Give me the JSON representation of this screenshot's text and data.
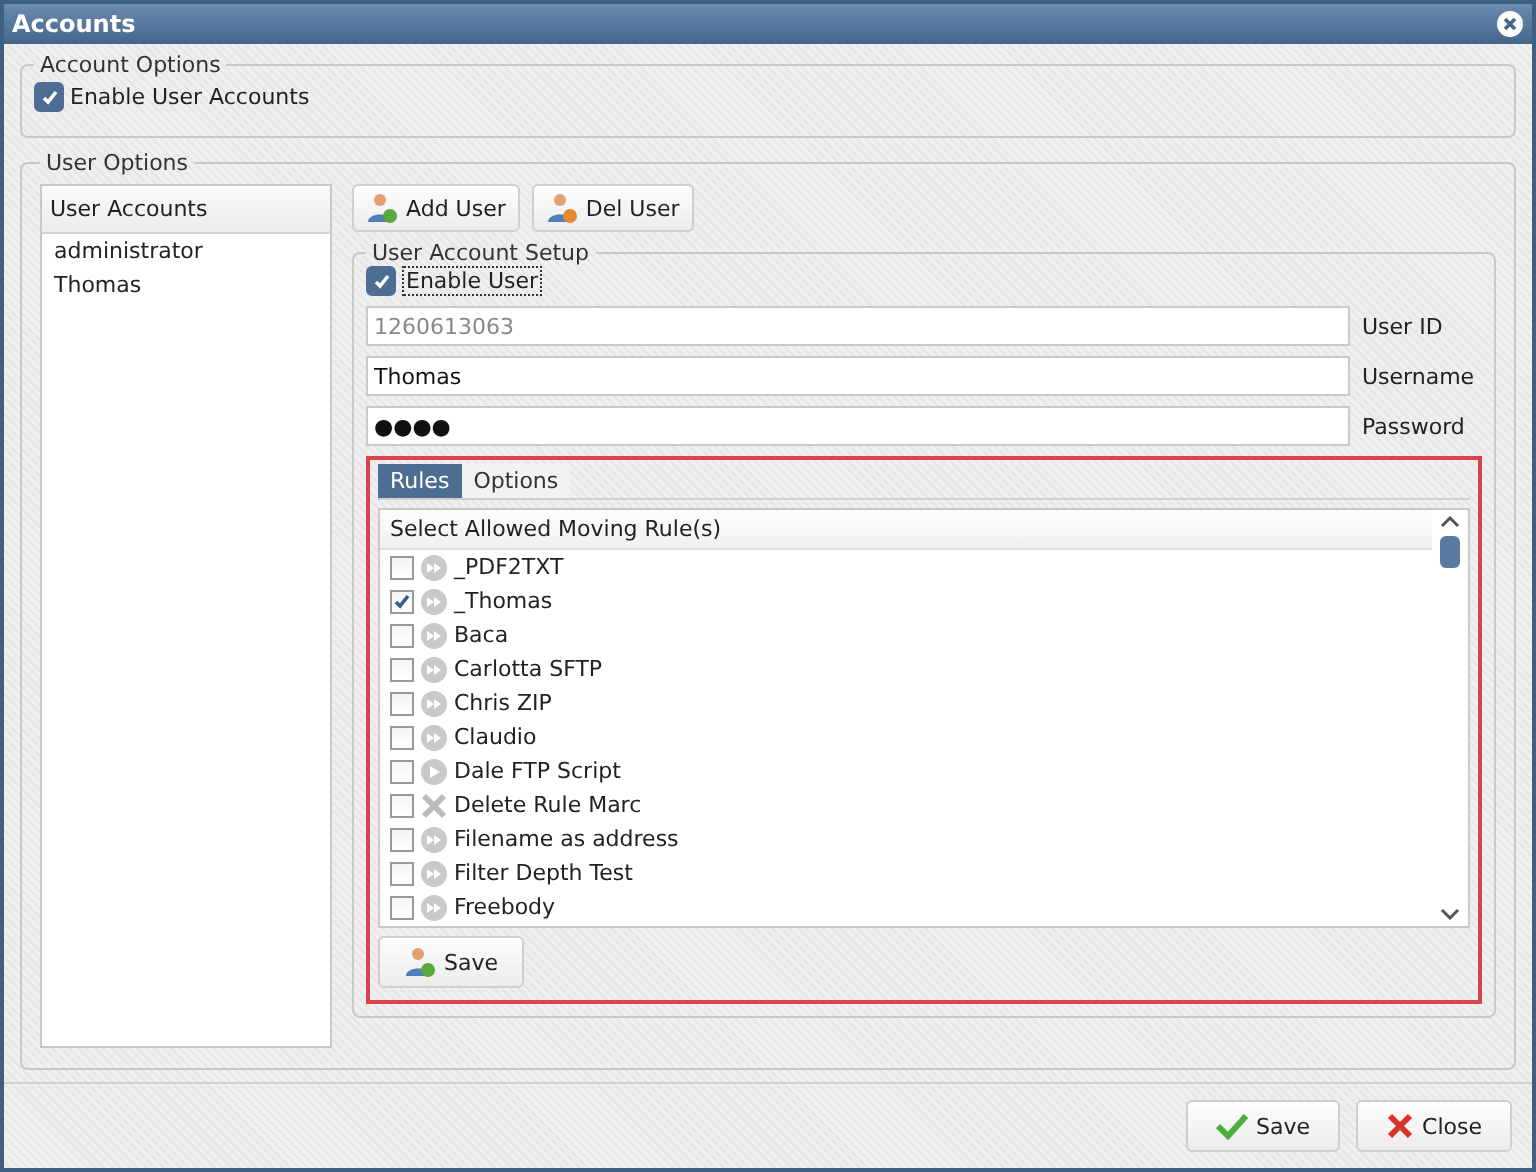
{
  "window": {
    "title": "Accounts"
  },
  "account_options": {
    "legend": "Account Options",
    "enable_accounts": {
      "label": "Enable User Accounts",
      "checked": true
    }
  },
  "user_options": {
    "legend": "User Options",
    "accounts_list": {
      "header": "User Accounts",
      "items": [
        {
          "label": "administrator",
          "selected": false
        },
        {
          "label": "Thomas",
          "selected": false
        }
      ]
    },
    "toolbar": [
      {
        "label": "Add User",
        "kind": "add"
      },
      {
        "label": "Del User",
        "kind": "delete"
      }
    ],
    "setup": {
      "legend": "User Account Setup",
      "enable_user": {
        "label": "Enable User",
        "checked": true
      },
      "fields": [
        {
          "label": "User ID",
          "value": "1260613063",
          "disabled": true
        },
        {
          "label": "Username",
          "value": "Thomas",
          "disabled": false
        },
        {
          "label": "Password",
          "value": "●●●●",
          "disabled": false
        }
      ],
      "tabs": [
        {
          "label": "Rules",
          "selected": true
        },
        {
          "label": "Options",
          "selected": false
        }
      ],
      "rules_header": "Select Allowed Moving Rule(s)",
      "rules": [
        {
          "label": "_PDF2TXT",
          "checked": false,
          "kind": "forward"
        },
        {
          "label": "_Thomas",
          "checked": true,
          "kind": "forward"
        },
        {
          "label": "Baca",
          "checked": false,
          "kind": "forward"
        },
        {
          "label": "Carlotta SFTP",
          "checked": false,
          "kind": "forward"
        },
        {
          "label": "Chris ZIP",
          "checked": false,
          "kind": "forward"
        },
        {
          "label": "Claudio",
          "checked": false,
          "kind": "forward"
        },
        {
          "label": "Dale FTP Script",
          "checked": false,
          "kind": "play"
        },
        {
          "label": "Delete Rule Marc",
          "checked": false,
          "kind": "delete"
        },
        {
          "label": "Filename as address",
          "checked": false,
          "kind": "forward"
        },
        {
          "label": "Filter Depth Test",
          "checked": false,
          "kind": "forward"
        },
        {
          "label": "Freebody",
          "checked": false,
          "kind": "forward"
        }
      ],
      "save_button": "Save"
    }
  },
  "footer_buttons": [
    {
      "label": "Save",
      "kind": "ok"
    },
    {
      "label": "Close",
      "kind": "cancel"
    }
  ]
}
